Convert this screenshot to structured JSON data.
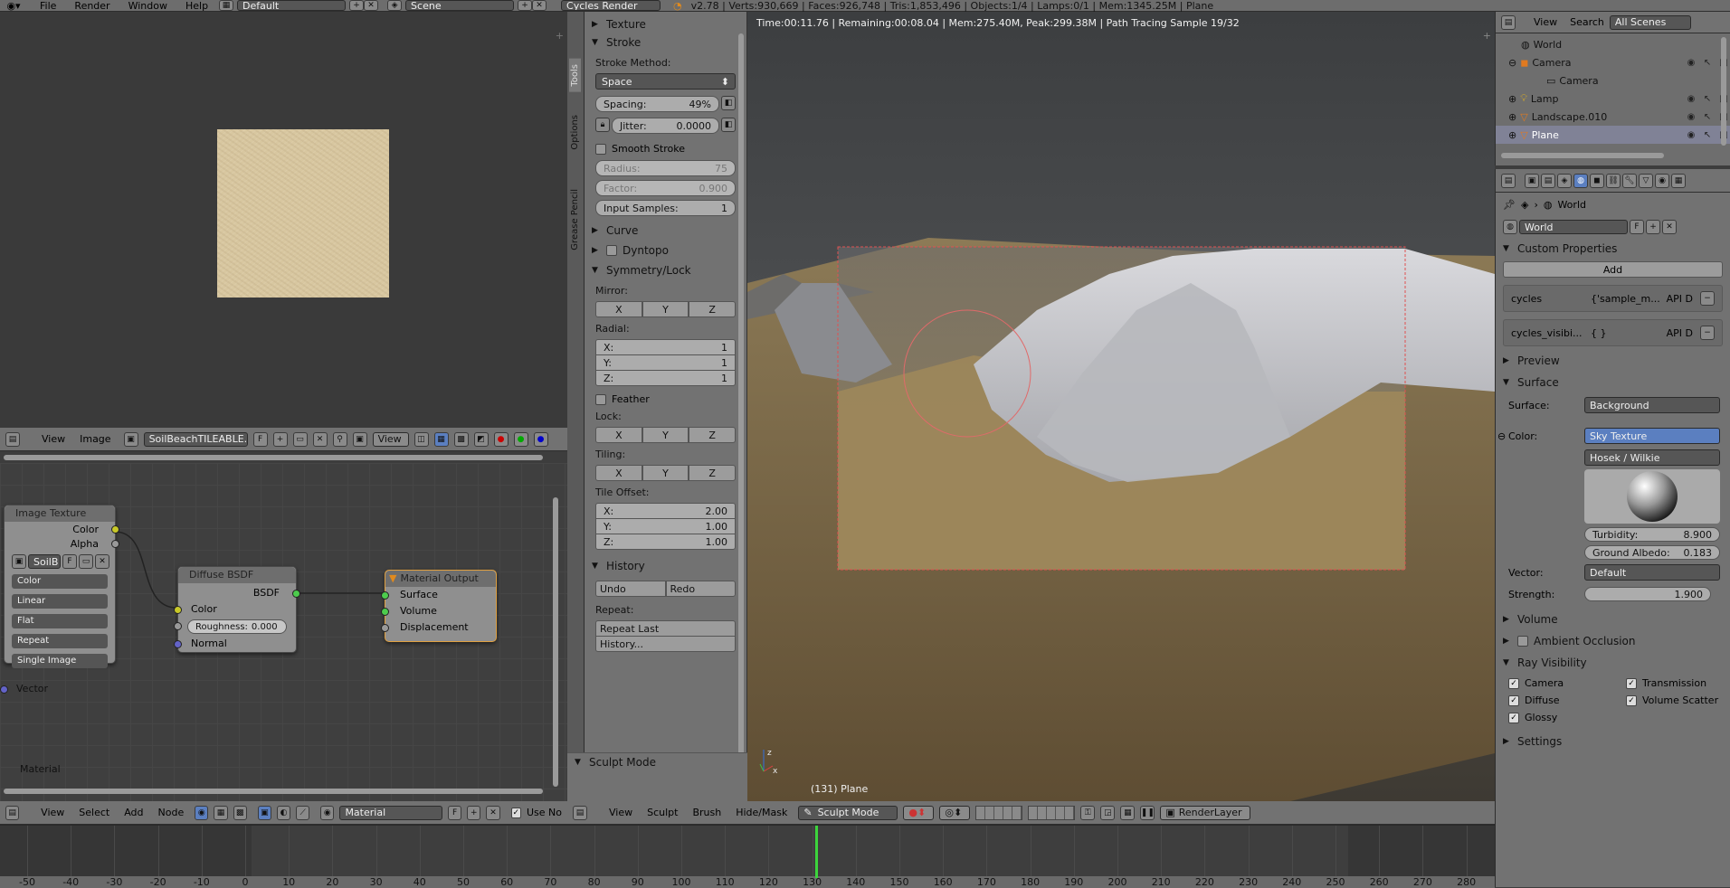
{
  "topbar": {
    "menus": [
      "File",
      "Render",
      "Window",
      "Help"
    ],
    "layout": "Default",
    "scene": "Scene",
    "engine": "Cycles Render",
    "stats": "v2.78 | Verts:930,669 | Faces:926,748 | Tris:1,853,496 | Objects:1/4 | Lamps:0/1 | Mem:1345.25M | Plane"
  },
  "image_editor": {
    "header": {
      "view": "View",
      "image": "Image",
      "image_name": "SoilBeachTILEABLE...",
      "fake": "F",
      "mode": "View"
    },
    "texture_color": "#d8c7a0"
  },
  "node_editor": {
    "image_texture": {
      "title": "Image Texture",
      "out_color": "Color",
      "out_alpha": "Alpha",
      "image_short": "SoilB",
      "fake": "F",
      "color_space": "Color",
      "interpolation": "Linear",
      "projection": "Flat",
      "extension": "Repeat",
      "source": "Single Image",
      "vector": "Vector"
    },
    "diffuse": {
      "title": "Diffuse BSDF",
      "out": "BSDF",
      "color": "Color",
      "roughness_label": "Roughness:",
      "roughness": "0.000",
      "normal": "Normal"
    },
    "output": {
      "title": "Material Output",
      "surface": "Surface",
      "volume": "Volume",
      "displacement": "Displacement"
    },
    "label": "Material",
    "header": {
      "menus": [
        "View",
        "Select",
        "Add",
        "Node"
      ],
      "material": "Material",
      "fake": "F",
      "use_nodes": "Use No"
    }
  },
  "tool_shelf": {
    "tabs": [
      "Tools",
      "Options",
      "Grease Pencil"
    ],
    "texture": "Texture",
    "stroke": "Stroke",
    "stroke_method_label": "Stroke Method:",
    "stroke_method": "Space",
    "spacing_label": "Spacing:",
    "spacing": "49%",
    "jitter_label": "Jitter:",
    "jitter": "0.0000",
    "smooth_stroke": "Smooth Stroke",
    "radius_label": "Radius:",
    "radius": "75",
    "factor_label": "Factor:",
    "factor": "0.900",
    "input_samples_label": "Input Samples:",
    "input_samples": "1",
    "curve": "Curve",
    "dyntopo": "Dyntopo",
    "symmetry": "Symmetry/Lock",
    "mirror": "Mirror:",
    "axes": [
      "X",
      "Y",
      "Z"
    ],
    "radial": "Radial:",
    "radial_x": "1",
    "radial_y": "1",
    "radial_z": "1",
    "x_label": "X:",
    "y_label": "Y:",
    "z_label": "Z:",
    "feather": "Feather",
    "lock": "Lock:",
    "tiling": "Tiling:",
    "tile_offset": "Tile Offset:",
    "off_x": "2.00",
    "off_y": "1.00",
    "off_z": "1.00",
    "history": "History",
    "undo": "Undo",
    "redo": "Redo",
    "repeat": "Repeat:",
    "repeat_last": "Repeat Last",
    "history_btn": "History...",
    "sculpt_mode": "Sculpt Mode"
  },
  "viewport": {
    "render_info": "Time:00:11.76 | Remaining:00:08.04 | Mem:275.40M, Peak:299.38M | Path Tracing Sample 19/32",
    "object_label": "(131) Plane",
    "header": {
      "menus": [
        "View",
        "Sculpt",
        "Brush",
        "Hide/Mask"
      ],
      "mode": "Sculpt Mode",
      "render_layer": "RenderLayer"
    }
  },
  "outliner": {
    "header": {
      "view": "View",
      "search": "Search",
      "scenes": "All Scenes"
    },
    "items": [
      "World",
      "Camera",
      "Camera",
      "Lamp",
      "Landscape.010",
      "Plane"
    ]
  },
  "properties": {
    "breadcrumb": "World",
    "world_name": "World",
    "fake": "F",
    "custom_props": "Custom Properties",
    "add": "Add",
    "props": [
      {
        "name": "cycles",
        "value": "{'sample_m...",
        "api": "API D"
      },
      {
        "name": "cycles_visibi...",
        "value": "{ }",
        "api": "API D"
      }
    ],
    "preview": "Preview",
    "surface_section": "Surface",
    "surface_label": "Surface:",
    "surface_value": "Background",
    "color_label": "Color:",
    "color_value": "Sky Texture",
    "sky_model": "Hosek / Wilkie",
    "turbidity_label": "Turbidity:",
    "turbidity": "8.900",
    "albedo_label": "Ground Albedo:",
    "albedo": "0.183",
    "vector_label": "Vector:",
    "vector_value": "Default",
    "strength_label": "Strength:",
    "strength": "1.900",
    "volume": "Volume",
    "ao": "Ambient Occlusion",
    "ray_vis": "Ray Visibility",
    "ray_items": [
      "Camera",
      "Transmission",
      "Diffuse",
      "Volume Scatter",
      "Glossy"
    ],
    "settings": "Settings"
  },
  "timeline": {
    "ticks": [
      "-50",
      "-40",
      "-30",
      "-20",
      "-10",
      "0",
      "10",
      "20",
      "30",
      "40",
      "50",
      "60",
      "70",
      "80",
      "90",
      "100",
      "110",
      "120",
      "130",
      "140",
      "150",
      "160",
      "170",
      "180",
      "190",
      "200",
      "210",
      "220",
      "230",
      "240",
      "250",
      "260",
      "270",
      "280"
    ],
    "current_frame": 131
  }
}
